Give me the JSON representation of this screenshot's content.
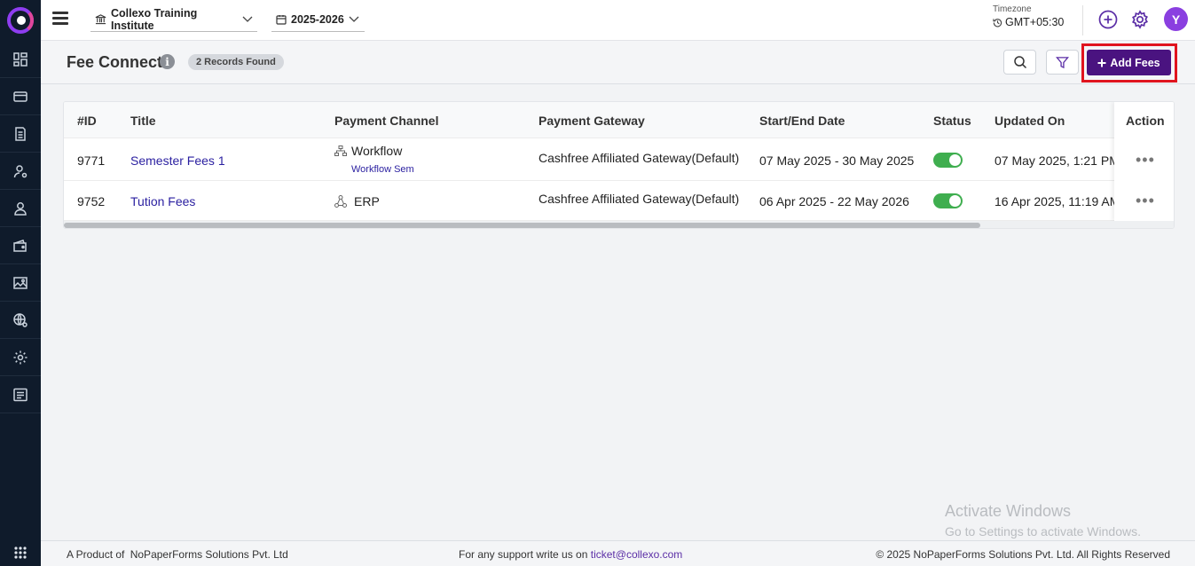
{
  "header": {
    "institute": "Collexo Training Institute",
    "academic_year": "2025-2026",
    "timezone_label": "Timezone",
    "timezone_value": "GMT+05:30",
    "avatar_initial": "Y"
  },
  "sidebar": {
    "icons": [
      "dashboard-icon",
      "card-icon",
      "document-icon",
      "user-settings-icon",
      "student-icon",
      "wallet-icon",
      "gallery-icon",
      "globe-settings-icon",
      "settings-icon",
      "form-icon"
    ],
    "bottom_icon": "apps-grid-icon"
  },
  "page": {
    "title": "Fee Connect",
    "records_badge": "2 Records Found",
    "add_button": "Add Fees"
  },
  "table": {
    "columns": [
      "#ID",
      "Title",
      "Payment Channel",
      "Payment Gateway",
      "Start/End Date",
      "Status",
      "Updated On",
      "Action"
    ],
    "rows": [
      {
        "id": "9771",
        "title": "Semester Fees 1",
        "channel": "Workflow",
        "channel_sub": "Workflow Sem",
        "gateway": "Cashfree Affiliated Gateway(Default)",
        "dates": "07 May 2025 - 30 May 2025",
        "status_on": true,
        "updated": "07 May 2025, 1:21 PM"
      },
      {
        "id": "9752",
        "title": "Tution Fees",
        "channel": "ERP",
        "channel_sub": "",
        "gateway": "Cashfree Affiliated Gateway(Default)",
        "dates": "06 Apr 2025 - 22 May 2026",
        "status_on": true,
        "updated": "16 Apr 2025, 11:19 AM"
      }
    ],
    "action_symbol": "•••"
  },
  "watermark": {
    "line1": "Activate Windows",
    "line2": "Go to Settings to activate Windows."
  },
  "footer": {
    "left_prefix": "A Product of",
    "left_company": "NoPaperForms Solutions Pvt. Ltd",
    "mid_text": "For any support write us on",
    "mid_email": "ticket@collexo.com",
    "right": "© 2025 NoPaperForms Solutions Pvt. Ltd. All Rights Reserved"
  },
  "colors": {
    "sidebar": "#0f1b2b",
    "primary": "#4a1380",
    "avatar": "#8a3fe0",
    "toggle_on": "#3fae4f",
    "highlight": "#e0141e",
    "link": "#2a1fa0"
  }
}
